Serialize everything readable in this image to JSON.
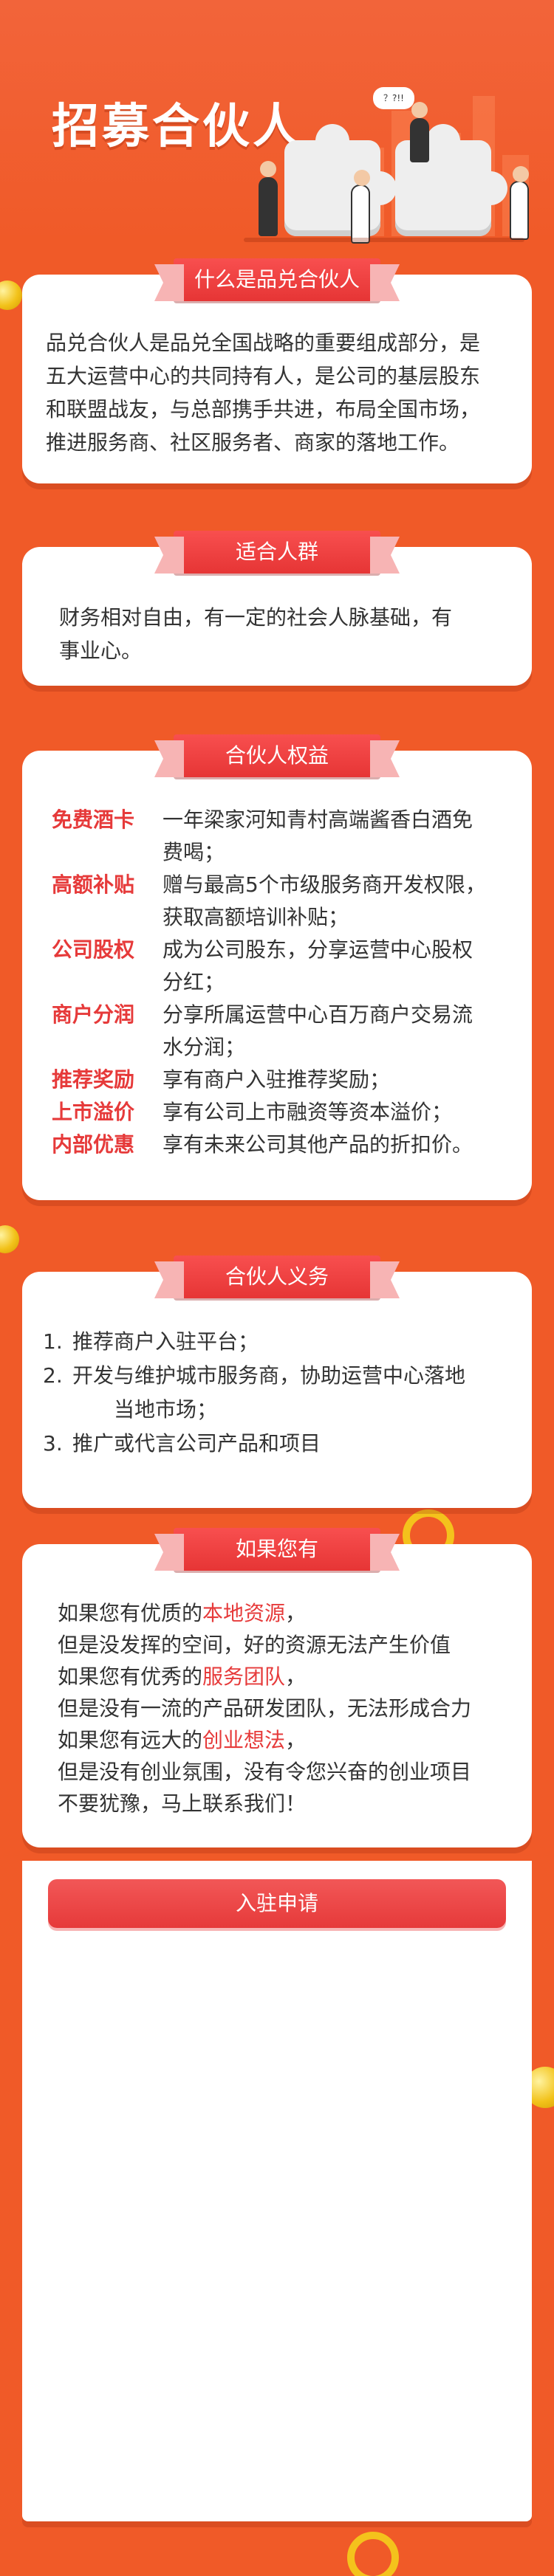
{
  "hero": {
    "title": "招募合伙人",
    "bubble_text": "？?!!"
  },
  "sections": {
    "about": {
      "title": "什么是品兑合伙人",
      "lines": [
        "品兑合伙人是品兑全国战略的重要组成部分，是",
        "五大运营中心的共同持有人，是公司的基层股东",
        "和联盟战友，与总部携手共进，布局全国市场，",
        "推进服务商、社区服务者、商家的落地工作。"
      ]
    },
    "suitable": {
      "title": "适合人群",
      "lines": [
        "财务相对自由，有一定的社会人脉基础，有",
        "事业心。"
      ]
    },
    "benefits": {
      "title": "合伙人权益",
      "items": [
        {
          "label": "免费酒卡",
          "lines": [
            "一年梁家河知青村高端酱香白酒免",
            "费喝；"
          ]
        },
        {
          "label": "高额补贴",
          "lines": [
            "赠与最高5个市级服务商开发权限，",
            "获取高额培训补贴；"
          ]
        },
        {
          "label": "公司股权",
          "lines": [
            "成为公司股东，分享运营中心股权",
            "分红；"
          ]
        },
        {
          "label": "商户分润",
          "lines": [
            "分享所属运营中心百万商户交易流",
            "水分润；"
          ]
        },
        {
          "label": "推荐奖励",
          "lines": [
            "享有商户入驻推荐奖励；"
          ]
        },
        {
          "label": "上市溢价",
          "lines": [
            "享有公司上市融资等资本溢价；"
          ]
        },
        {
          "label": "内部优惠",
          "lines": [
            "享有未来公司其他产品的折扣价。"
          ]
        }
      ]
    },
    "duties": {
      "title": "合伙人义务",
      "items": [
        {
          "num": "1.",
          "lines": [
            "推荐商户入驻平台；"
          ]
        },
        {
          "num": "2.",
          "lines": [
            "开发与维护城市服务商，协助运营中心落地",
            "当地市场；"
          ]
        },
        {
          "num": "3.",
          "lines": [
            "推广或代言公司产品和项目"
          ]
        }
      ]
    },
    "ifyou": {
      "title": "如果您有",
      "l1_pre": "如果您有优质的",
      "l1_hl": "本地资源",
      "l1_post": "，",
      "l2": "但是没发挥的空间，好的资源无法产生价值",
      "l3_pre": "如果您有优秀的",
      "l3_hl": "服务团队",
      "l3_post": "，",
      "l4": "但是没有一流的产品研发团队，无法形成合力",
      "l5_pre": "如果您有远大的",
      "l5_hl": "创业想法",
      "l5_post": "，",
      "l6": "但是没有创业氛围，没有令您兴奋的创业项目",
      "l7": "不要犹豫，马上联系我们！"
    }
  },
  "apply": {
    "button_label": "入驻申请"
  },
  "colors": {
    "background": "#f05a28",
    "accent": "#e63a3a",
    "gold": "#f4c21c"
  }
}
